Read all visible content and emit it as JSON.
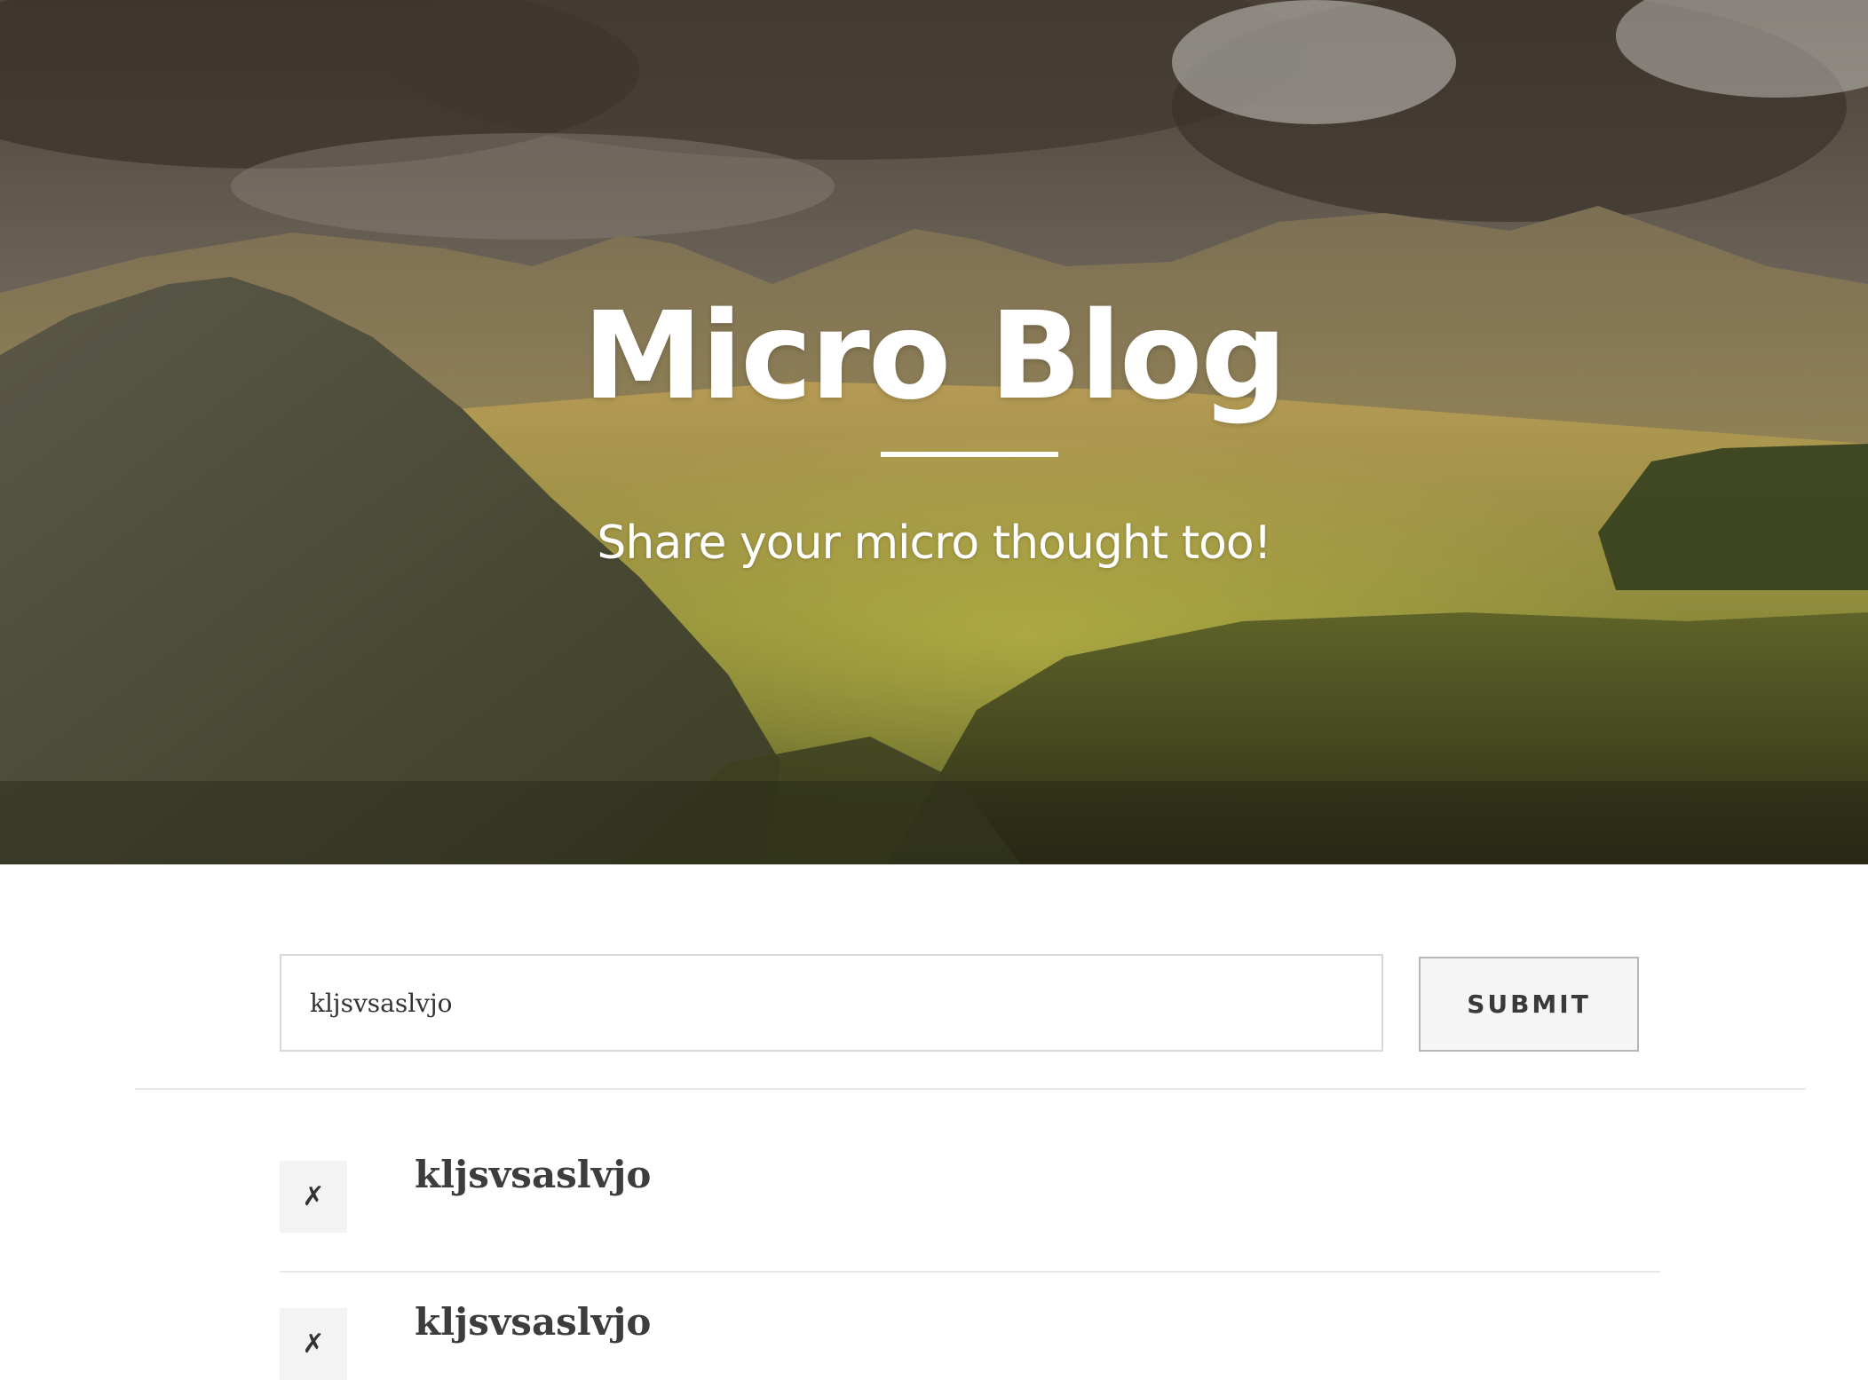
{
  "hero": {
    "title": "Micro Blog",
    "subtitle": "Share your micro thought too!",
    "background": "mountain-valley-photo"
  },
  "compose": {
    "input_value": "kljsvsaslvjo",
    "submit_label": "SUBMIT"
  },
  "posts": [
    {
      "text": "kljsvsaslvjo",
      "delete_label": "✗"
    },
    {
      "text": "kljsvsaslvjo",
      "delete_label": "✗"
    }
  ],
  "colors": {
    "accent_text": "#3d3d3d",
    "button_bg": "#f5f5f5",
    "divider": "#e8e8e8"
  }
}
